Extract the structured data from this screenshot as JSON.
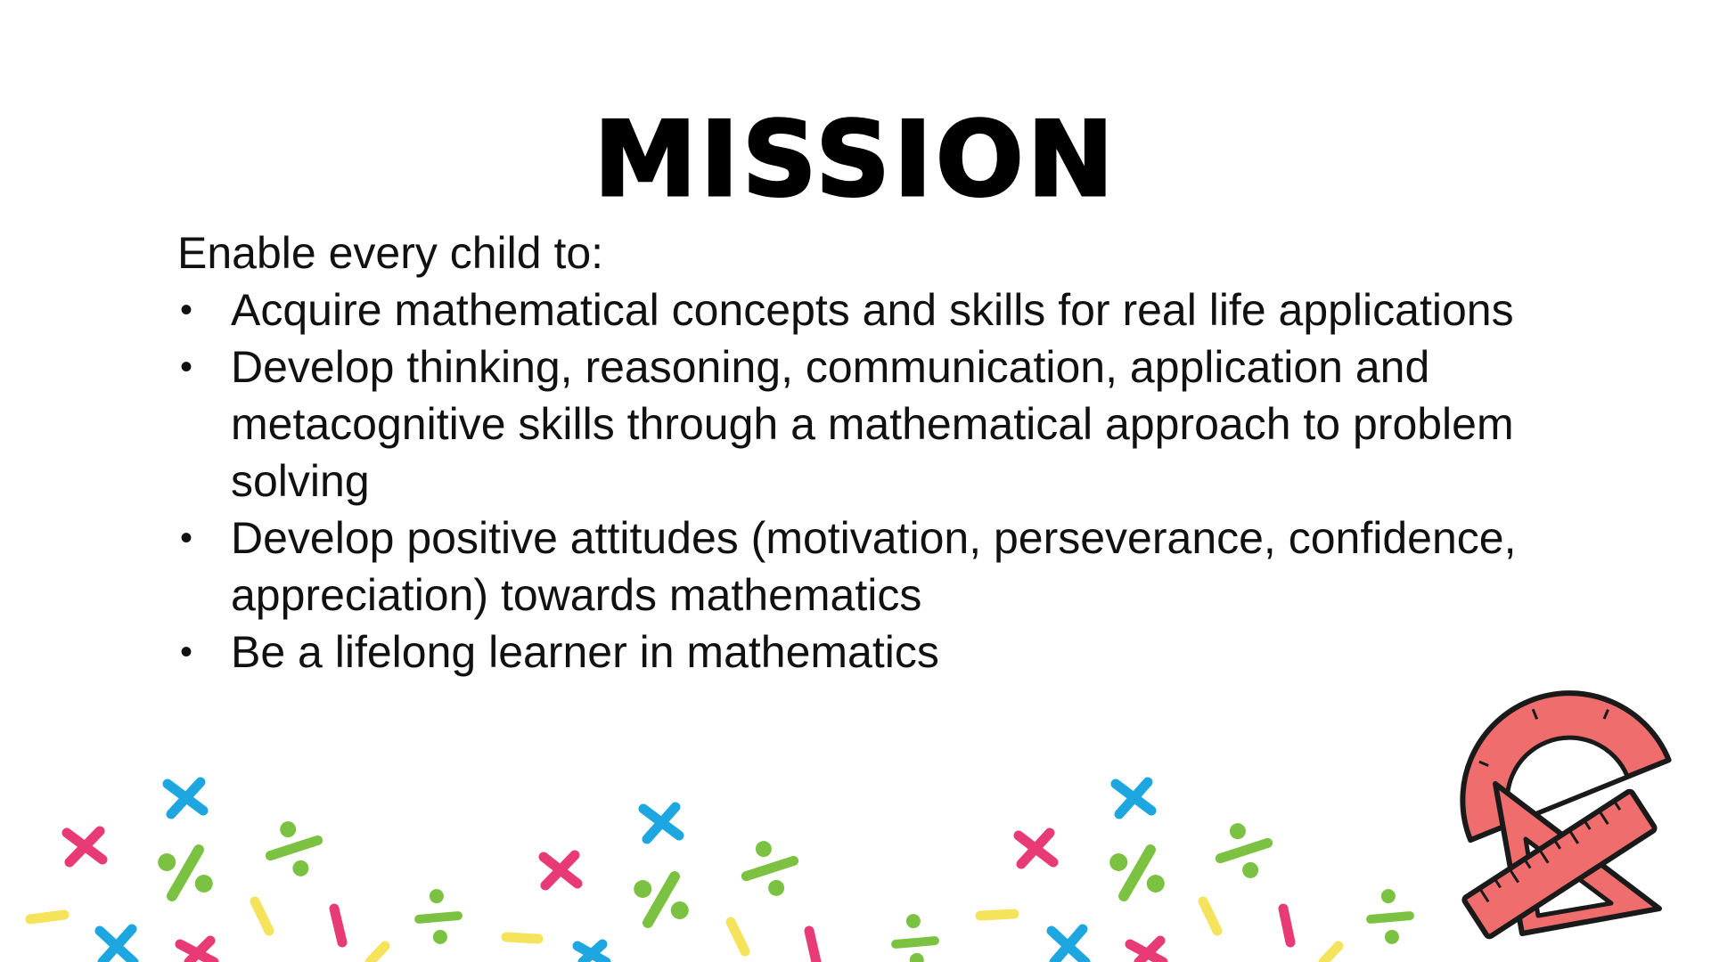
{
  "slide": {
    "title": "MISSION",
    "intro": "Enable every child to:",
    "bullets": [
      "Acquire mathematical concepts and skills for real life applications",
      "Develop thinking, reasoning, communication, application and metacognitive skills through a mathematical approach to problem solving",
      "Develop positive attitudes (motivation, perseverance, confidence, appreciation) towards mathematics",
      "Be a lifelong learner in mathematics"
    ],
    "bullet_glyph": "•"
  },
  "decoration": {
    "icons": [
      "multiply-sign-icon",
      "divide-sign-icon",
      "minus-sign-icon",
      "protractor-icon",
      "set-square-icon",
      "ruler-icon"
    ],
    "colors": {
      "pink": "#e83a74",
      "blue": "#1ea6e0",
      "green": "#7cc242",
      "yellow": "#f5e35c",
      "tool_fill": "#f06d6d",
      "tool_outline": "#1a1a1a"
    }
  }
}
